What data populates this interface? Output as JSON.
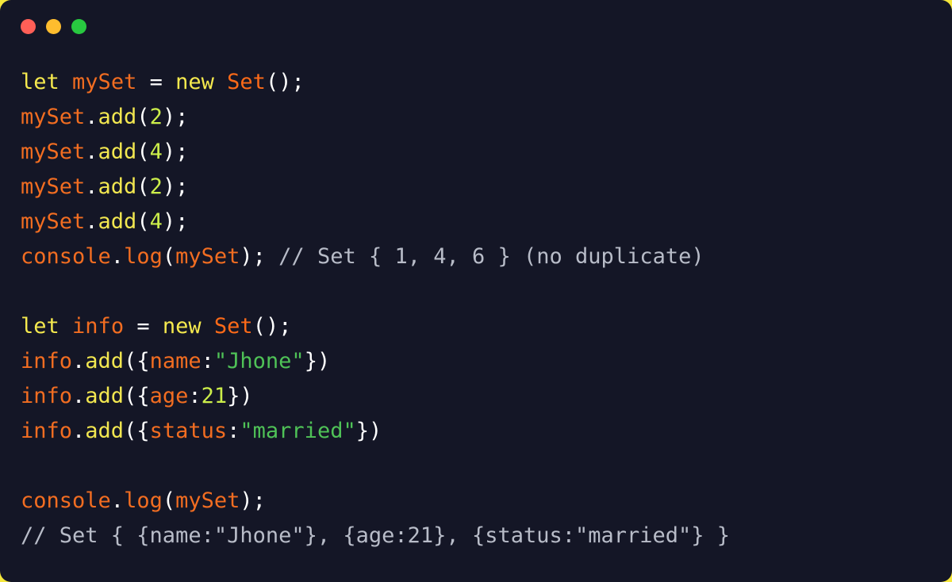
{
  "window": {
    "background_color": "#141626",
    "page_background_color": "#f5e73c",
    "controls": [
      {
        "name": "close",
        "color": "#ff5f57"
      },
      {
        "name": "minimize",
        "color": "#ffbd2e"
      },
      {
        "name": "maximize",
        "color": "#28c840"
      }
    ]
  },
  "theme": {
    "keyword": "#f5e94e",
    "identifier": "#f26d21",
    "class": "#fd6a18",
    "method": "#f2e750",
    "number": "#ccee4a",
    "string": "#4fc257",
    "punctuation": "#ffffff",
    "comment": "#b8bcc8"
  },
  "code": {
    "language": "javascript",
    "lines": [
      {
        "index": 1,
        "text": "let mySet = new Set();",
        "tokens": [
          {
            "t": "let",
            "c": "kw"
          },
          {
            "t": " ",
            "c": "punc"
          },
          {
            "t": "mySet",
            "c": "ident"
          },
          {
            "t": " ",
            "c": "punc"
          },
          {
            "t": "=",
            "c": "punc"
          },
          {
            "t": " ",
            "c": "punc"
          },
          {
            "t": "new",
            "c": "kw"
          },
          {
            "t": " ",
            "c": "punc"
          },
          {
            "t": "Set",
            "c": "cls"
          },
          {
            "t": "();",
            "c": "punc"
          }
        ]
      },
      {
        "index": 2,
        "text": "mySet.add(2);",
        "tokens": [
          {
            "t": "mySet",
            "c": "ident"
          },
          {
            "t": ".",
            "c": "punc"
          },
          {
            "t": "add",
            "c": "meth"
          },
          {
            "t": "(",
            "c": "punc"
          },
          {
            "t": "2",
            "c": "num"
          },
          {
            "t": ");",
            "c": "punc"
          }
        ]
      },
      {
        "index": 3,
        "text": "mySet.add(4);",
        "tokens": [
          {
            "t": "mySet",
            "c": "ident"
          },
          {
            "t": ".",
            "c": "punc"
          },
          {
            "t": "add",
            "c": "meth"
          },
          {
            "t": "(",
            "c": "punc"
          },
          {
            "t": "4",
            "c": "num"
          },
          {
            "t": ");",
            "c": "punc"
          }
        ]
      },
      {
        "index": 4,
        "text": "mySet.add(2);",
        "tokens": [
          {
            "t": "mySet",
            "c": "ident"
          },
          {
            "t": ".",
            "c": "punc"
          },
          {
            "t": "add",
            "c": "meth"
          },
          {
            "t": "(",
            "c": "punc"
          },
          {
            "t": "2",
            "c": "num"
          },
          {
            "t": ");",
            "c": "punc"
          }
        ]
      },
      {
        "index": 5,
        "text": "mySet.add(4);",
        "tokens": [
          {
            "t": "mySet",
            "c": "ident"
          },
          {
            "t": ".",
            "c": "punc"
          },
          {
            "t": "add",
            "c": "meth"
          },
          {
            "t": "(",
            "c": "punc"
          },
          {
            "t": "4",
            "c": "num"
          },
          {
            "t": ");",
            "c": "punc"
          }
        ]
      },
      {
        "index": 6,
        "text": "console.log(mySet); // Set { 1, 4, 6 } (no duplicate)",
        "tokens": [
          {
            "t": "console",
            "c": "ident"
          },
          {
            "t": ".",
            "c": "punc"
          },
          {
            "t": "log",
            "c": "ident"
          },
          {
            "t": "(",
            "c": "punc"
          },
          {
            "t": "mySet",
            "c": "ident"
          },
          {
            "t": ");",
            "c": "punc"
          },
          {
            "t": " ",
            "c": "punc"
          },
          {
            "t": "// Set { 1, 4, 6 } (no duplicate)",
            "c": "comment"
          }
        ]
      },
      {
        "index": 7,
        "text": "",
        "tokens": []
      },
      {
        "index": 8,
        "text": "let info = new Set();",
        "tokens": [
          {
            "t": "let",
            "c": "kw"
          },
          {
            "t": " ",
            "c": "punc"
          },
          {
            "t": "info",
            "c": "ident"
          },
          {
            "t": " ",
            "c": "punc"
          },
          {
            "t": "=",
            "c": "punc"
          },
          {
            "t": " ",
            "c": "punc"
          },
          {
            "t": "new",
            "c": "kw"
          },
          {
            "t": " ",
            "c": "punc"
          },
          {
            "t": "Set",
            "c": "cls"
          },
          {
            "t": "();",
            "c": "punc"
          }
        ]
      },
      {
        "index": 9,
        "text": "info.add({name:\"Jhone\"})",
        "tokens": [
          {
            "t": "info",
            "c": "ident"
          },
          {
            "t": ".",
            "c": "punc"
          },
          {
            "t": "add",
            "c": "meth"
          },
          {
            "t": "({",
            "c": "punc"
          },
          {
            "t": "name",
            "c": "prop"
          },
          {
            "t": ":",
            "c": "punc"
          },
          {
            "t": "\"Jhone\"",
            "c": "str"
          },
          {
            "t": "})",
            "c": "punc"
          }
        ]
      },
      {
        "index": 10,
        "text": "info.add({age:21})",
        "tokens": [
          {
            "t": "info",
            "c": "ident"
          },
          {
            "t": ".",
            "c": "punc"
          },
          {
            "t": "add",
            "c": "meth"
          },
          {
            "t": "({",
            "c": "punc"
          },
          {
            "t": "age",
            "c": "prop"
          },
          {
            "t": ":",
            "c": "punc"
          },
          {
            "t": "21",
            "c": "num"
          },
          {
            "t": "})",
            "c": "punc"
          }
        ]
      },
      {
        "index": 11,
        "text": "info.add({status:\"married\"})",
        "tokens": [
          {
            "t": "info",
            "c": "ident"
          },
          {
            "t": ".",
            "c": "punc"
          },
          {
            "t": "add",
            "c": "meth"
          },
          {
            "t": "({",
            "c": "punc"
          },
          {
            "t": "status",
            "c": "prop"
          },
          {
            "t": ":",
            "c": "punc"
          },
          {
            "t": "\"married\"",
            "c": "str"
          },
          {
            "t": "})",
            "c": "punc"
          }
        ]
      },
      {
        "index": 12,
        "text": "",
        "tokens": []
      },
      {
        "index": 13,
        "text": "console.log(mySet);",
        "tokens": [
          {
            "t": "console",
            "c": "ident"
          },
          {
            "t": ".",
            "c": "punc"
          },
          {
            "t": "log",
            "c": "ident"
          },
          {
            "t": "(",
            "c": "punc"
          },
          {
            "t": "mySet",
            "c": "ident"
          },
          {
            "t": ");",
            "c": "punc"
          }
        ]
      },
      {
        "index": 14,
        "text": "// Set { {name:\"Jhone\"}, {age:21}, {status:\"married\"} }",
        "tokens": [
          {
            "t": "// Set { {name:\"Jhone\"}, {age:21}, {status:\"married\"} }",
            "c": "comment"
          }
        ]
      }
    ]
  }
}
